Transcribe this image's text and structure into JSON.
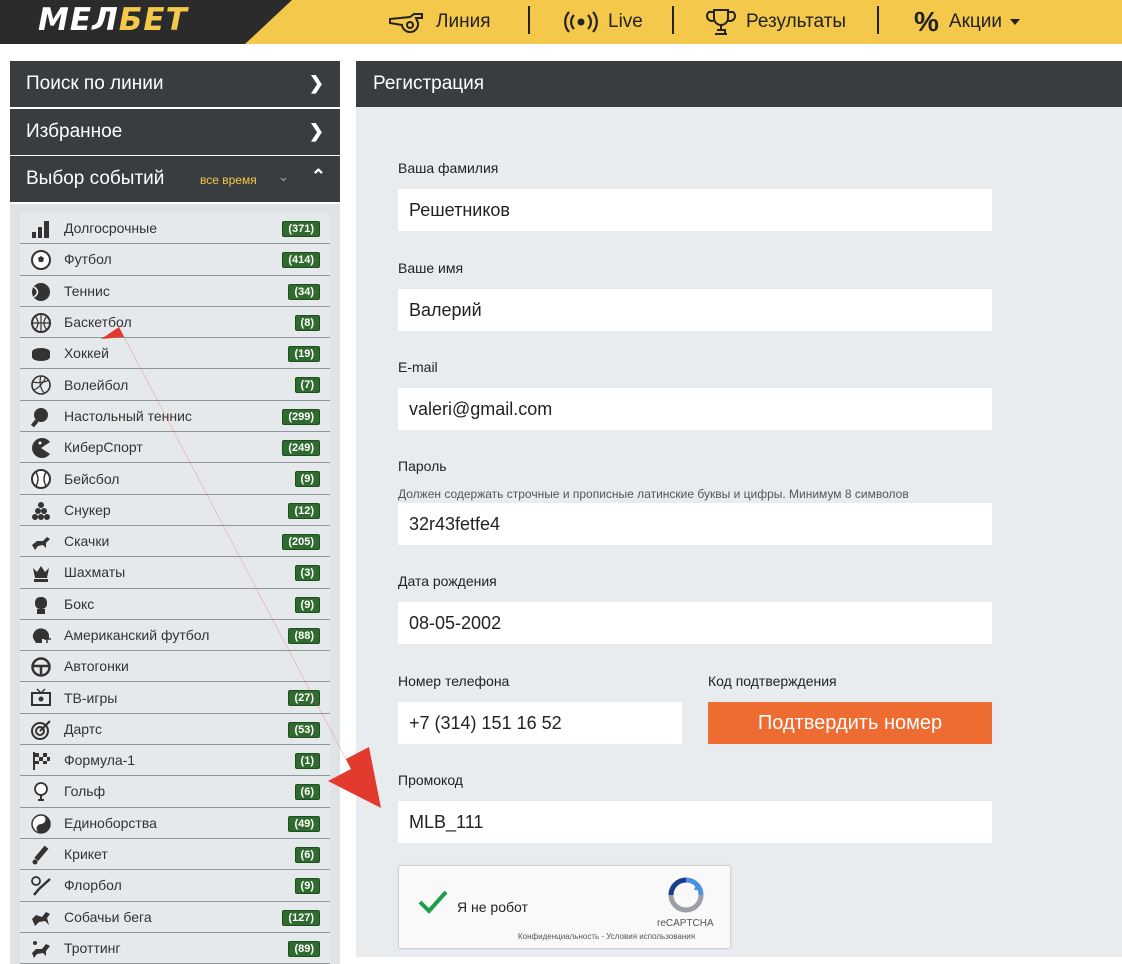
{
  "header": {
    "logo_left": "МЕЛ",
    "logo_right": "БЕТ",
    "nav": [
      {
        "label": "Линия",
        "icon": "whistle-icon"
      },
      {
        "label": "Live",
        "icon": "live-broadcast-icon"
      },
      {
        "label": "Результаты",
        "icon": "trophy-icon"
      },
      {
        "label": "Акции",
        "icon": "percent-icon"
      }
    ]
  },
  "sidebar": {
    "search_label": "Поиск по линии",
    "favorites_label": "Избранное",
    "events_label": "Выбор событий",
    "period_label": "все время",
    "sports": [
      {
        "name": "Долгосрочные",
        "count": "(371)",
        "icon": "bar-chart-icon"
      },
      {
        "name": "Футбол",
        "count": "(414)",
        "icon": "soccer-ball-icon"
      },
      {
        "name": "Теннис",
        "count": "(34)",
        "icon": "tennis-ball-icon"
      },
      {
        "name": "Баскетбол",
        "count": "(8)",
        "icon": "basketball-icon"
      },
      {
        "name": "Хоккей",
        "count": "(19)",
        "icon": "hockey-puck-icon"
      },
      {
        "name": "Волейбол",
        "count": "(7)",
        "icon": "volleyball-icon"
      },
      {
        "name": "Настольный теннис",
        "count": "(299)",
        "icon": "ping-pong-icon"
      },
      {
        "name": "КиберСпорт",
        "count": "(249)",
        "icon": "esports-icon"
      },
      {
        "name": "Бейсбол",
        "count": "(9)",
        "icon": "baseball-icon"
      },
      {
        "name": "Снукер",
        "count": "(12)",
        "icon": "snooker-icon"
      },
      {
        "name": "Скачки",
        "count": "(205)",
        "icon": "horse-racing-icon"
      },
      {
        "name": "Шахматы",
        "count": "(3)",
        "icon": "chess-icon"
      },
      {
        "name": "Бокс",
        "count": "(9)",
        "icon": "boxing-glove-icon"
      },
      {
        "name": "Американский футбол",
        "count": "(88)",
        "icon": "football-helmet-icon"
      },
      {
        "name": "Автогонки",
        "count": "",
        "icon": "steering-wheel-icon"
      },
      {
        "name": "ТВ-игры",
        "count": "(27)",
        "icon": "tv-icon"
      },
      {
        "name": "Дартс",
        "count": "(53)",
        "icon": "darts-icon"
      },
      {
        "name": "Формула-1",
        "count": "(1)",
        "icon": "checkered-flag-icon"
      },
      {
        "name": "Гольф",
        "count": "(6)",
        "icon": "golf-icon"
      },
      {
        "name": "Единоборства",
        "count": "(49)",
        "icon": "yin-yang-icon"
      },
      {
        "name": "Крикет",
        "count": "(6)",
        "icon": "cricket-bat-icon"
      },
      {
        "name": "Флорбол",
        "count": "(9)",
        "icon": "floorball-icon"
      },
      {
        "name": "Собачьи бега",
        "count": "(127)",
        "icon": "dog-racing-icon"
      },
      {
        "name": "Троттинг",
        "count": "(89)",
        "icon": "trotting-icon"
      }
    ]
  },
  "registration": {
    "title": "Регистрация",
    "surname_label": "Ваша фамилия",
    "surname_value": "Решетников",
    "name_label": "Ваше имя",
    "name_value": "Валерий",
    "email_label": "E-mail",
    "email_value": "valeri@gmail.com",
    "password_label": "Пароль",
    "password_hint": "Должен содержать строчные и прописные латинские буквы и цифры. Минимум 8 символов",
    "password_value": "32r43fetfe4",
    "birthdate_label": "Дата рождения",
    "birthdate_value": "08-05-2002",
    "phone_label": "Номер телефона",
    "phone_value": "+7 (314) 151 16 52",
    "code_label": "Код подтверждения",
    "confirm_button": "Подтвердить номер",
    "promo_label": "Промокод",
    "promo_value": "MLB_111",
    "captcha_text": "Я не робот",
    "captcha_brand": "reCAPTCHA",
    "captcha_terms": "Конфиденциальность - Условия использования"
  },
  "colors": {
    "header_yellow": "#f4c84a",
    "dark": "#3a3d40",
    "confirm_orange": "#ee6b32",
    "badge_green": "#2f6b2f",
    "arrow_red": "#e23b2e"
  }
}
